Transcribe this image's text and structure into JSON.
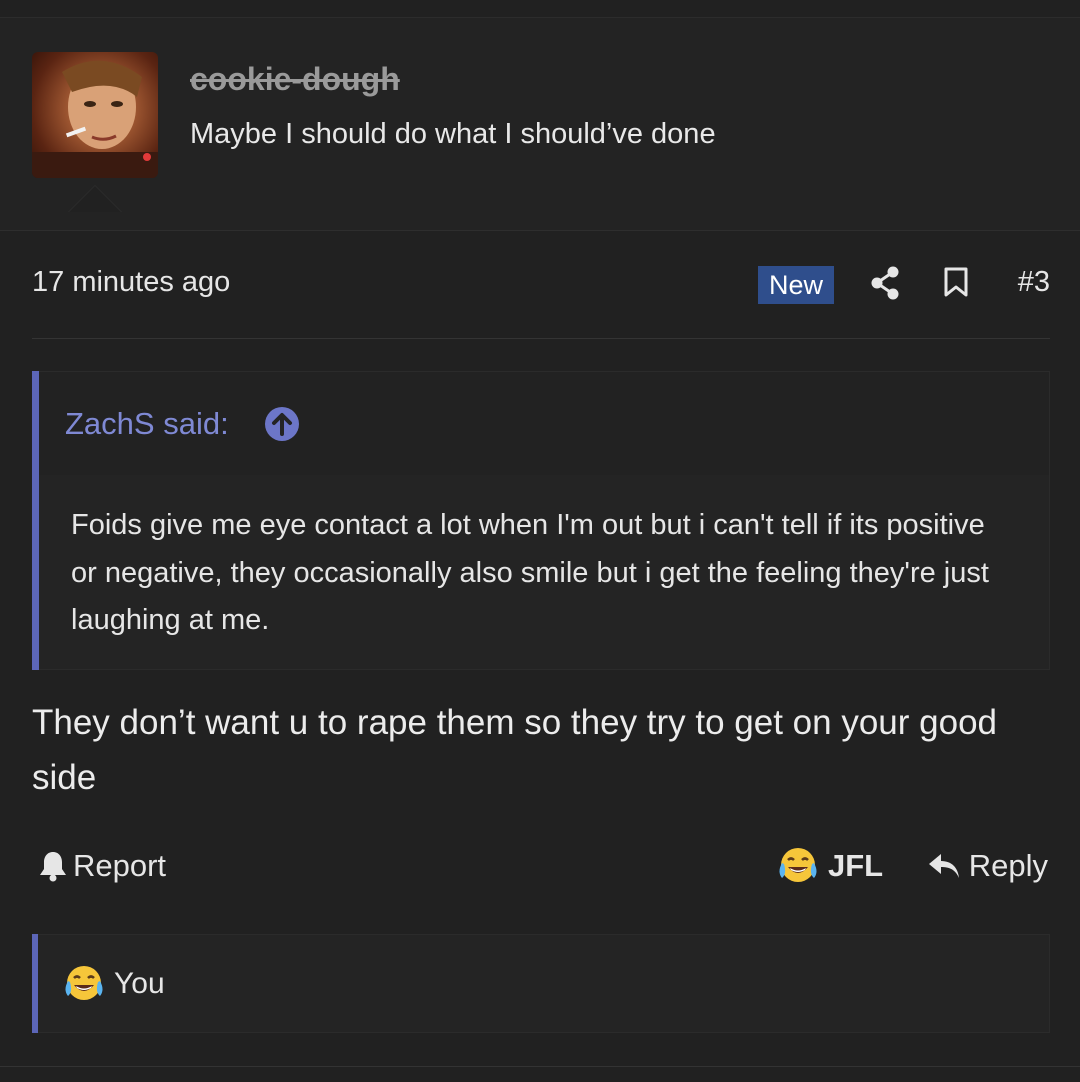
{
  "post": {
    "username": "cookie-dough",
    "user_title": "Maybe I should do what I should’ve done",
    "timestamp": "17 minutes ago",
    "badge": "New",
    "number": "#3"
  },
  "quote": {
    "author": "ZachS said:",
    "body": "Foids give me eye contact a lot when I'm out but i can't tell if its positive or negative, they occasionally also smile but i get the feeling they're just laughing at me."
  },
  "message": "They don’t want u to rape them so they try to get on your good side",
  "actions": {
    "report_label": "Report",
    "jfl_label": "JFL",
    "reply_label": "Reply"
  },
  "reactions": {
    "label": "You"
  },
  "icons": {
    "share": "share-icon",
    "bookmark": "bookmark-icon",
    "quote_up": "arrow-up-circle-icon",
    "report": "bell-icon",
    "jfl": "tears-of-joy-emoji-icon",
    "reply": "reply-arrow-icon"
  },
  "colors": {
    "background": "#212121",
    "accent": "#5c66b8",
    "quote_author": "#7f89d4",
    "new_badge": "#2f4e8c"
  }
}
